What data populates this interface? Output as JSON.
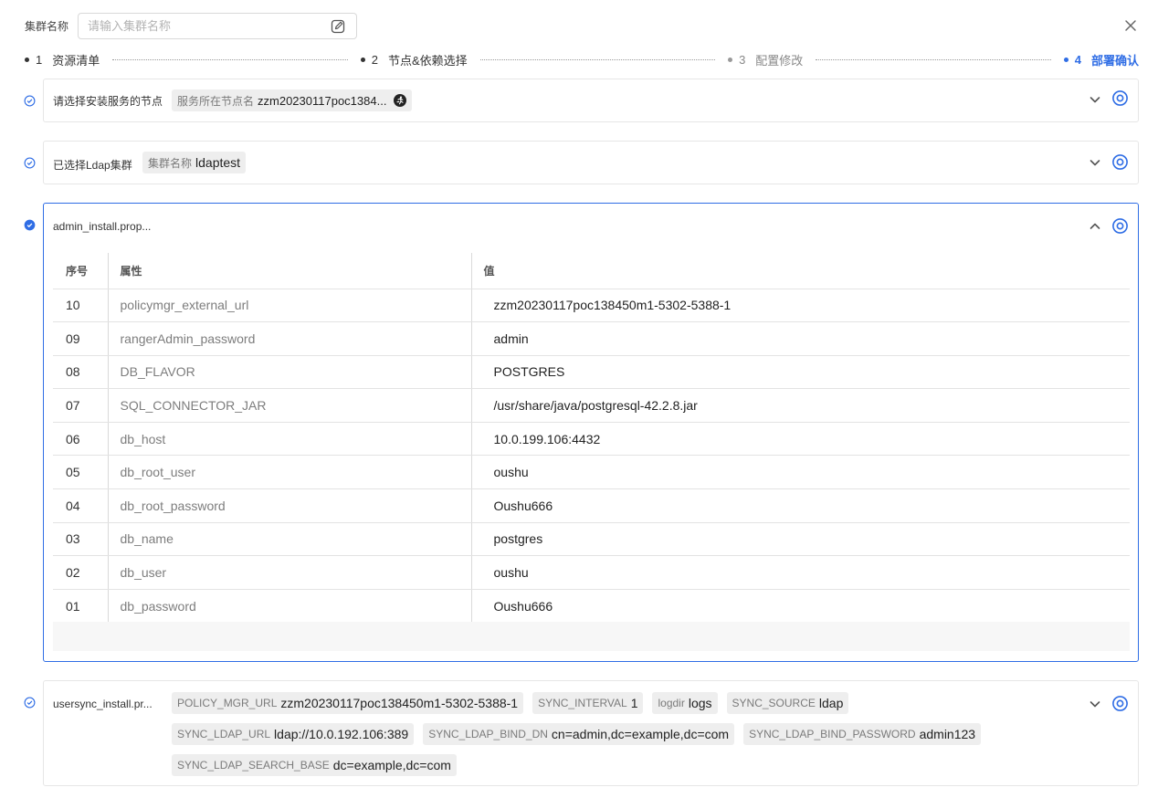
{
  "header": {
    "name_label": "集群名称",
    "name_placeholder": "请输入集群名称"
  },
  "steps": [
    {
      "num": "1",
      "label": "资源清单",
      "state": "done"
    },
    {
      "num": "2",
      "label": "节点&依赖选择",
      "state": "done"
    },
    {
      "num": "3",
      "label": "配置修改",
      "state": "todo"
    },
    {
      "num": "4",
      "label": "部署确认",
      "state": "active"
    }
  ],
  "node_card": {
    "title": "请选择安装服务的节点",
    "tag_key": "服务所在节点名",
    "tag_value": "zzm20230117poc1384..."
  },
  "ldap_card": {
    "title": "已选择Ldap集群",
    "tag_key": "集群名称",
    "tag_value": "ldaptest"
  },
  "admin_card": {
    "title": "admin_install.prop...",
    "columns": [
      "序号",
      "属性",
      "值"
    ],
    "rows": [
      {
        "idx": "10",
        "key": "policymgr_external_url",
        "value": "zzm20230117poc138450m1-5302-5388-1"
      },
      {
        "idx": "09",
        "key": "rangerAdmin_password",
        "value": "admin"
      },
      {
        "idx": "08",
        "key": "DB_FLAVOR",
        "value": "POSTGRES"
      },
      {
        "idx": "07",
        "key": "SQL_CONNECTOR_JAR",
        "value": "/usr/share/java/postgresql-42.2.8.jar"
      },
      {
        "idx": "06",
        "key": "db_host",
        "value": "10.0.199.106:4432"
      },
      {
        "idx": "05",
        "key": "db_root_user",
        "value": "oushu"
      },
      {
        "idx": "04",
        "key": "db_root_password",
        "value": "Oushu666"
      },
      {
        "idx": "03",
        "key": "db_name",
        "value": "postgres"
      },
      {
        "idx": "02",
        "key": "db_user",
        "value": "oushu"
      },
      {
        "idx": "01",
        "key": "db_password",
        "value": "Oushu666"
      }
    ]
  },
  "usersync_card": {
    "title": "usersync_install.pr...",
    "tags": [
      {
        "key": "POLICY_MGR_URL",
        "value": "zzm20230117poc138450m1-5302-5388-1"
      },
      {
        "key": "SYNC_INTERVAL",
        "value": "1"
      },
      {
        "key": "logdir",
        "value": "logs"
      },
      {
        "key": "SYNC_SOURCE",
        "value": "ldap"
      },
      {
        "key": "SYNC_LDAP_URL",
        "value": "ldap://10.0.192.106:389"
      },
      {
        "key": "SYNC_LDAP_BIND_DN",
        "value": "cn=admin,dc=example,dc=com"
      },
      {
        "key": "SYNC_LDAP_BIND_PASSWORD",
        "value": "admin123"
      },
      {
        "key": "SYNC_LDAP_SEARCH_BASE",
        "value": "dc=example,dc=com"
      }
    ]
  },
  "icons": {
    "edit": "edit-icon",
    "close": "close-icon",
    "check": "check-circle-icon",
    "chevron": "chevron-icon",
    "settings": "settings-icon",
    "node": "run-icon"
  },
  "colors": {
    "accent": "#2f6de5",
    "tag_bg": "#eeeeee",
    "border": "#e6e6e6"
  }
}
